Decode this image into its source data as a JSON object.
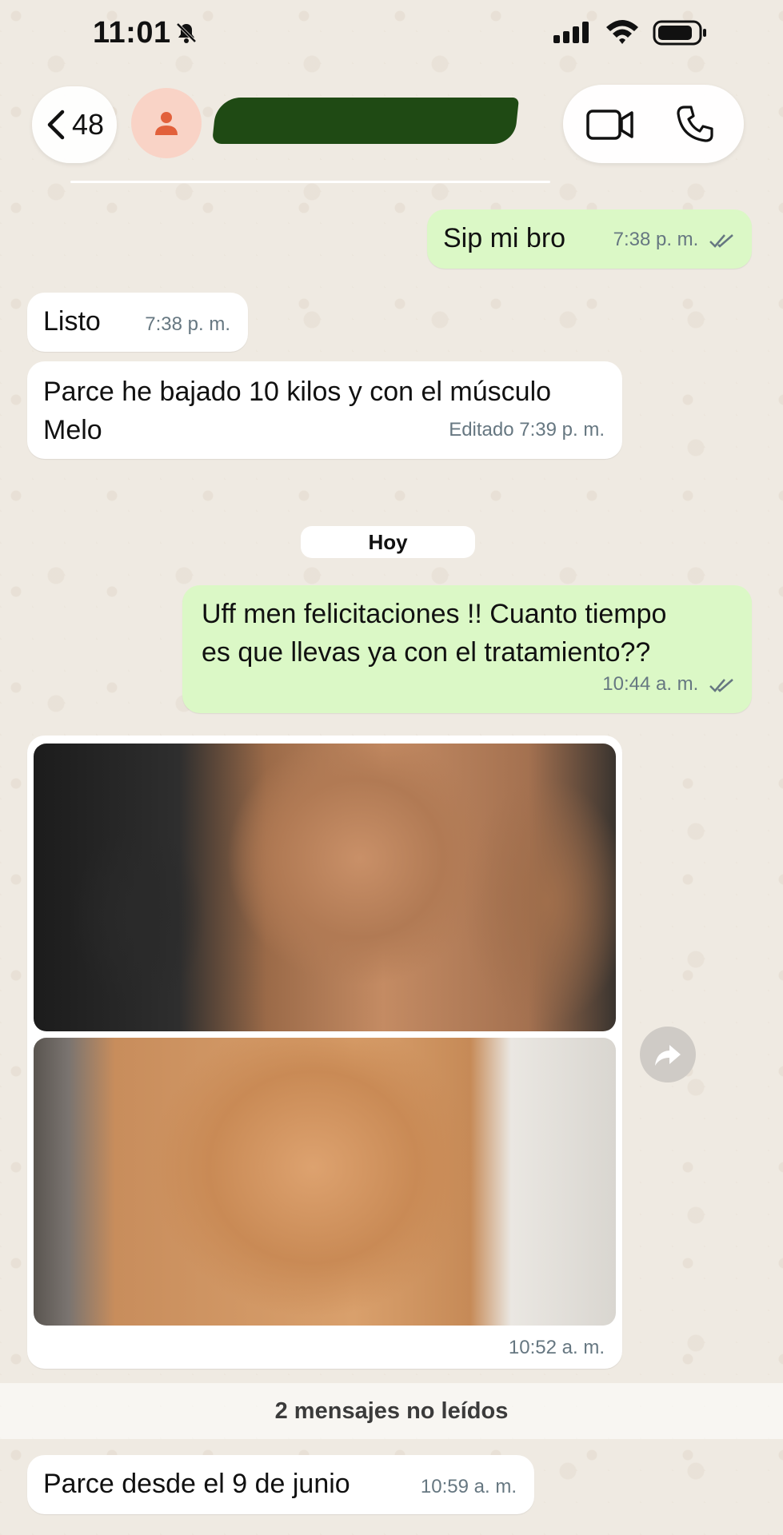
{
  "status_bar": {
    "time": "11:01",
    "icons": [
      "bell-slash-icon",
      "signal-icon",
      "wifi-icon",
      "battery-icon"
    ]
  },
  "header": {
    "back_count": "48",
    "icons": [
      "chevron-left-icon",
      "person-icon",
      "video-camera-icon",
      "phone-icon"
    ],
    "avatar_color": "#f9d3c6",
    "name_redaction_color": "#1f4a14"
  },
  "messages": [
    {
      "direction": "out",
      "text": "Sip mi bro",
      "time": "7:38 p. m.",
      "status": "read"
    },
    {
      "direction": "in",
      "text": "Listo",
      "time": "7:38 p. m."
    },
    {
      "direction": "in",
      "text_line1": "Parce he bajado 10 kilos y con el músculo",
      "text_line2": "Melo",
      "time": "Editado 7:39 p. m."
    },
    {
      "direction": "out",
      "text_line1": "Uff men felicitaciones !! Cuanto tiempo",
      "text_line2": "es que llevas ya con el tratamiento??",
      "time": "10:44 a. m.",
      "status": "read"
    },
    {
      "direction": "in",
      "type": "photos",
      "count": 2,
      "time": "10:52 a. m."
    },
    {
      "direction": "in",
      "text": "Parce desde el 9 de junio",
      "time": "10:59 a. m."
    }
  ],
  "day_separator": "Hoy",
  "unread_banner": "2 mensajes no leídos",
  "colors": {
    "chat_background": "#efeae2",
    "outgoing_bubble": "#dbf8c6",
    "incoming_bubble": "#ffffff",
    "meta_text": "#667781",
    "read_ticks": "#667781"
  }
}
